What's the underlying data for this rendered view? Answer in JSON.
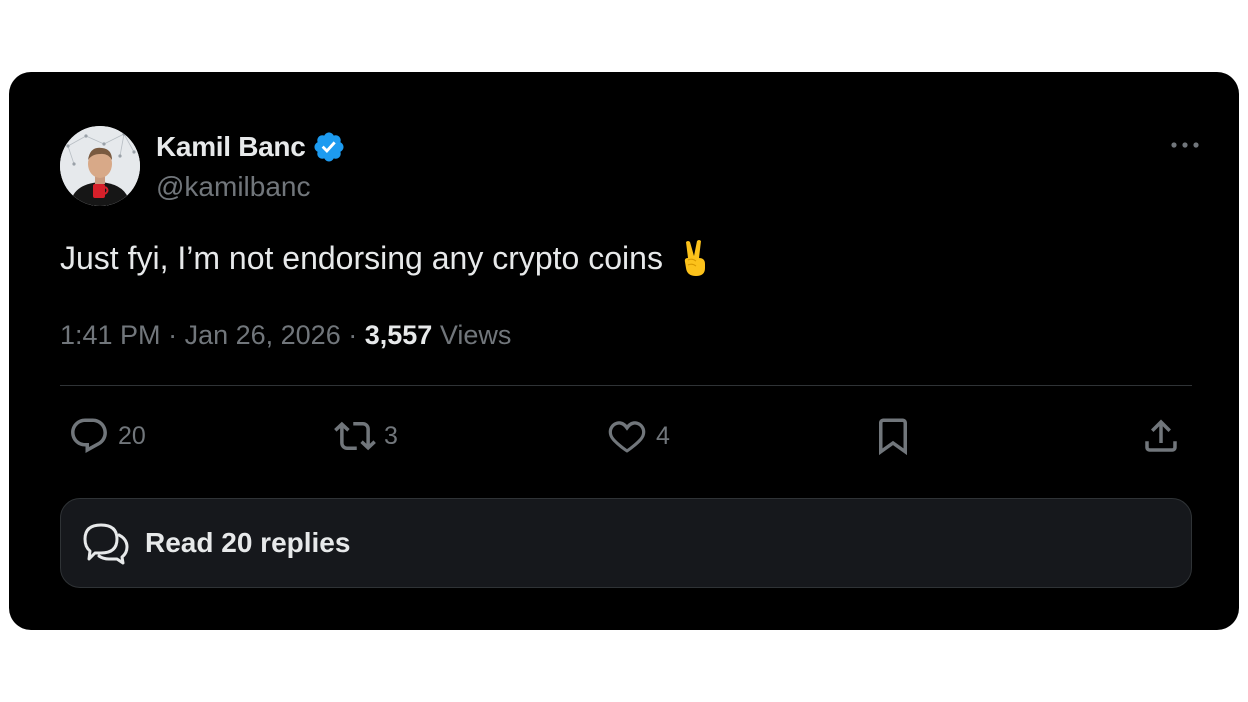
{
  "author": {
    "name": "Kamil Banc",
    "handle": "@kamilbanc",
    "verified": true
  },
  "tweet": {
    "text": "Just fyi, I’m not endorsing any crypto coins",
    "emoji": "victory-hand-emoji",
    "time": "1:41 PM",
    "date": "Jan 26, 2026",
    "views_count": "3,557",
    "views_label": "Views"
  },
  "actions": {
    "replies": "20",
    "retweets": "3",
    "likes": "4"
  },
  "read_replies": {
    "label": "Read 20 replies"
  },
  "colors": {
    "background": "#000000",
    "text_primary": "#e7e9ea",
    "text_secondary": "#71767b",
    "verified_badge": "#1d9bf0",
    "divider": "#2f3336"
  },
  "icons": [
    "more-icon",
    "verified-icon",
    "reply-icon",
    "retweet-icon",
    "like-icon",
    "bookmark-icon",
    "share-icon",
    "conversation-icon"
  ]
}
